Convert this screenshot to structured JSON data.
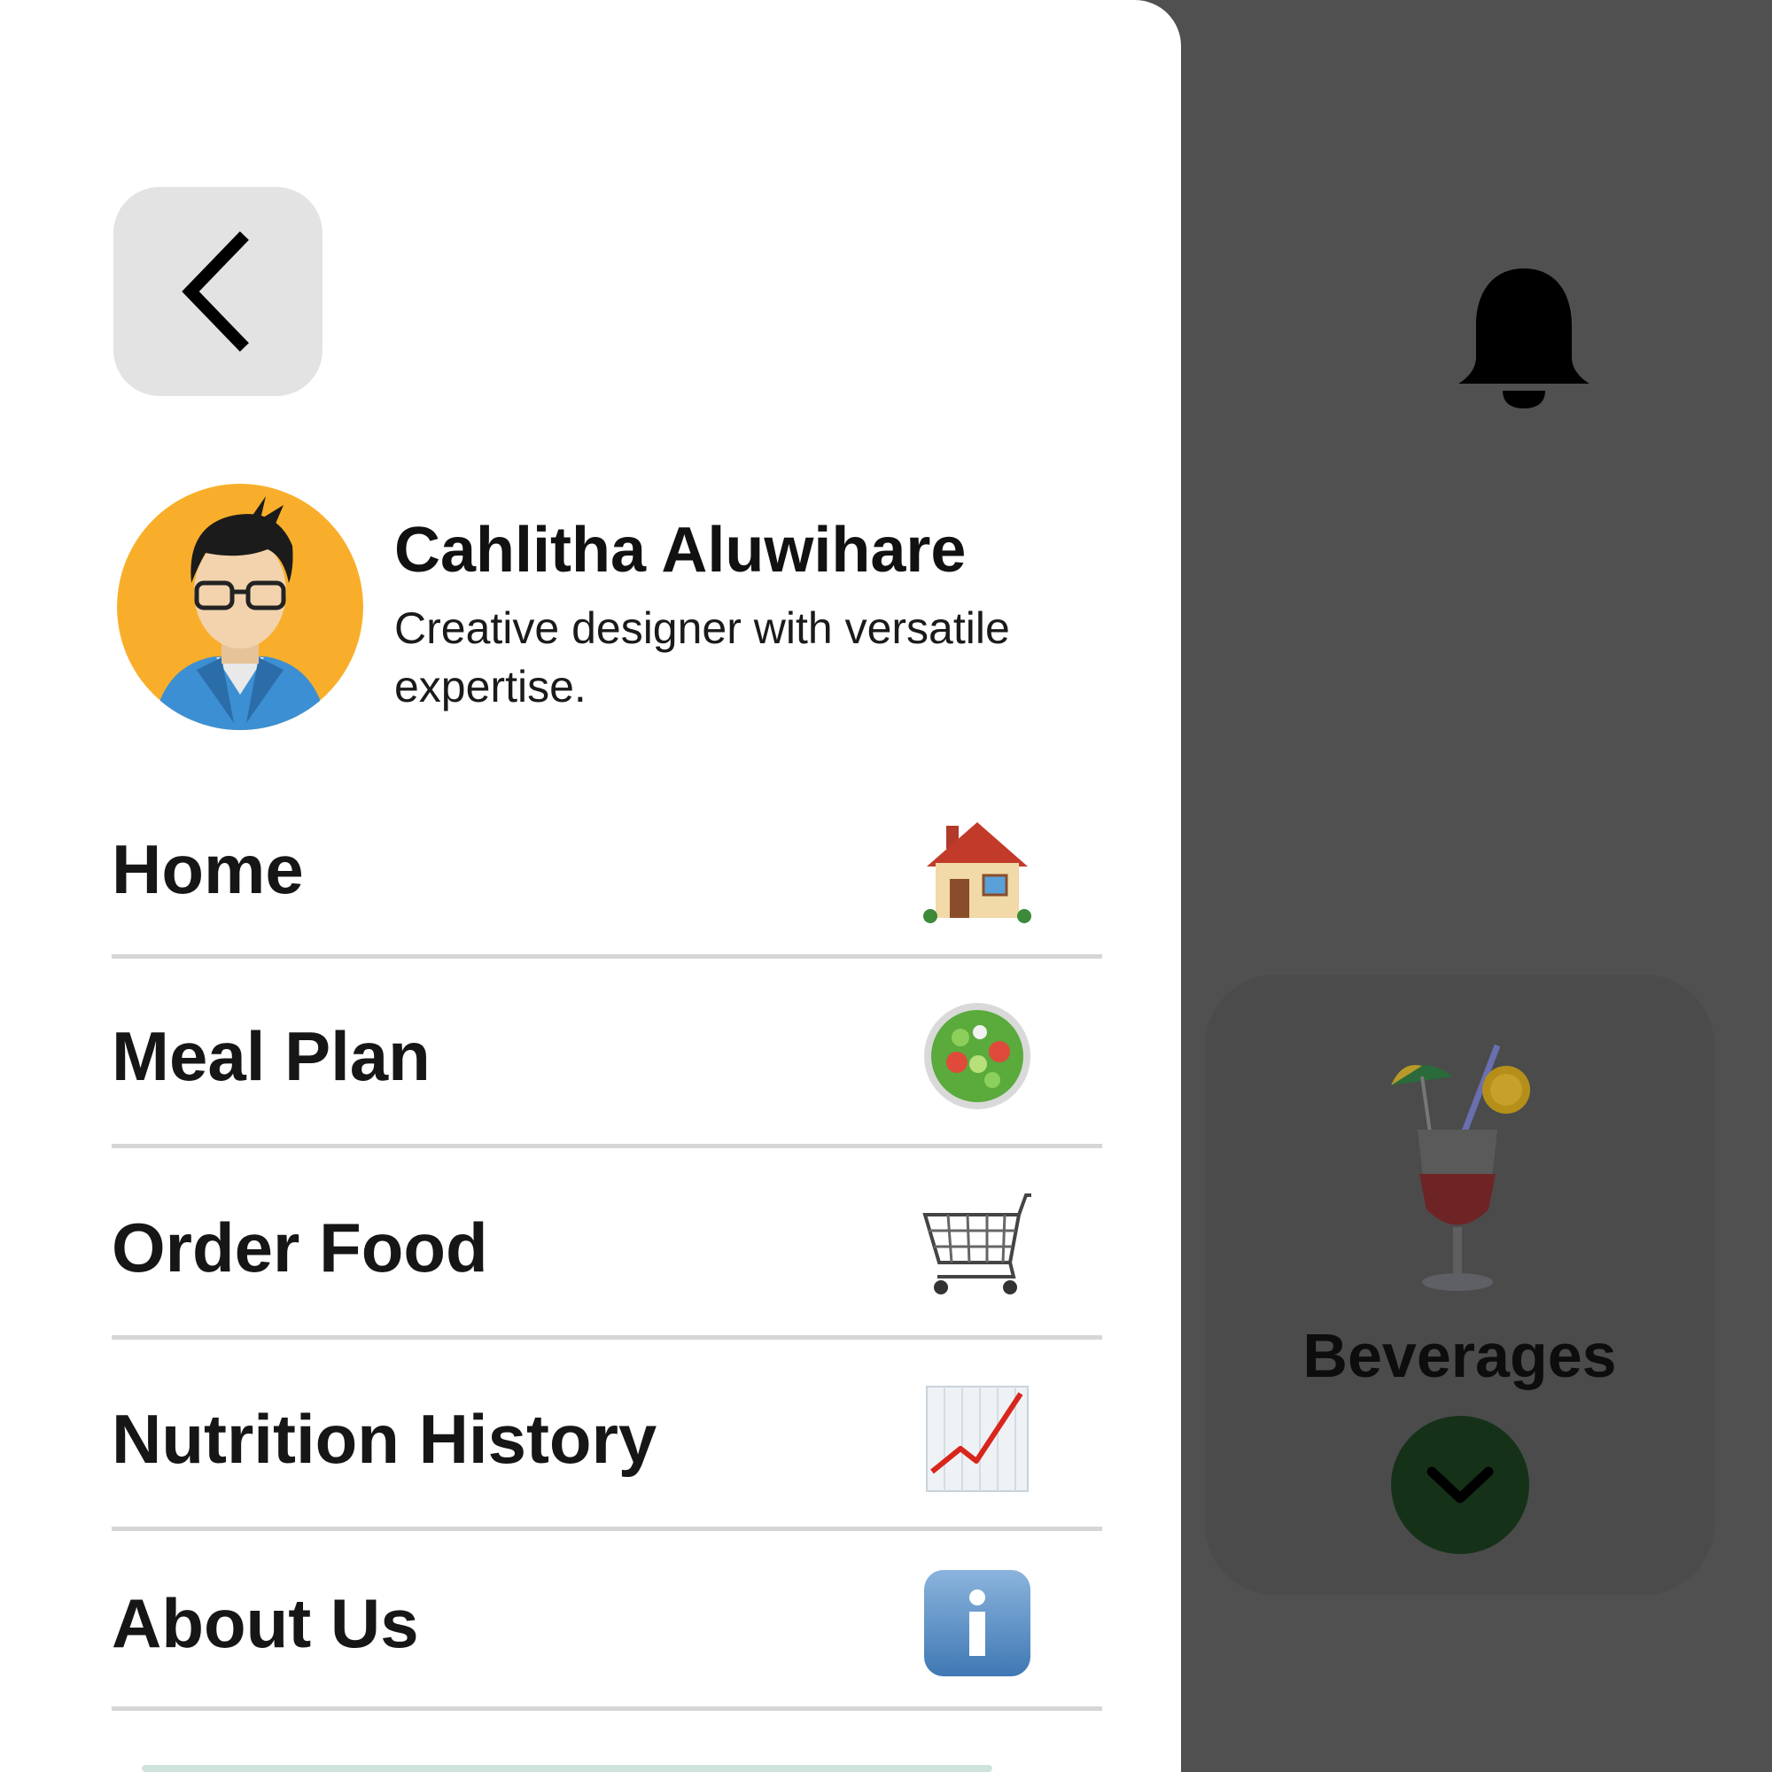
{
  "drawer": {
    "profile": {
      "name": "Cahlitha Aluwihare",
      "bio": "Creative designer with versatile expertise."
    },
    "menu": [
      {
        "label": "Home",
        "icon": "house-icon"
      },
      {
        "label": "Meal Plan",
        "icon": "salad-icon"
      },
      {
        "label": "Order Food",
        "icon": "shopping-cart-icon"
      },
      {
        "label": "Nutrition History",
        "icon": "chart-increasing-icon"
      },
      {
        "label": "About Us",
        "icon": "info-icon"
      }
    ]
  },
  "background": {
    "category": {
      "label": "Beverages",
      "icon": "tropical-drink-icon"
    }
  },
  "colors": {
    "drawer_bg": "#ffffff",
    "overlay": "#505050",
    "back_button_bg": "#e3e3e3",
    "expand_button": "#153219",
    "avatar_bg": "#f9ae2b"
  }
}
